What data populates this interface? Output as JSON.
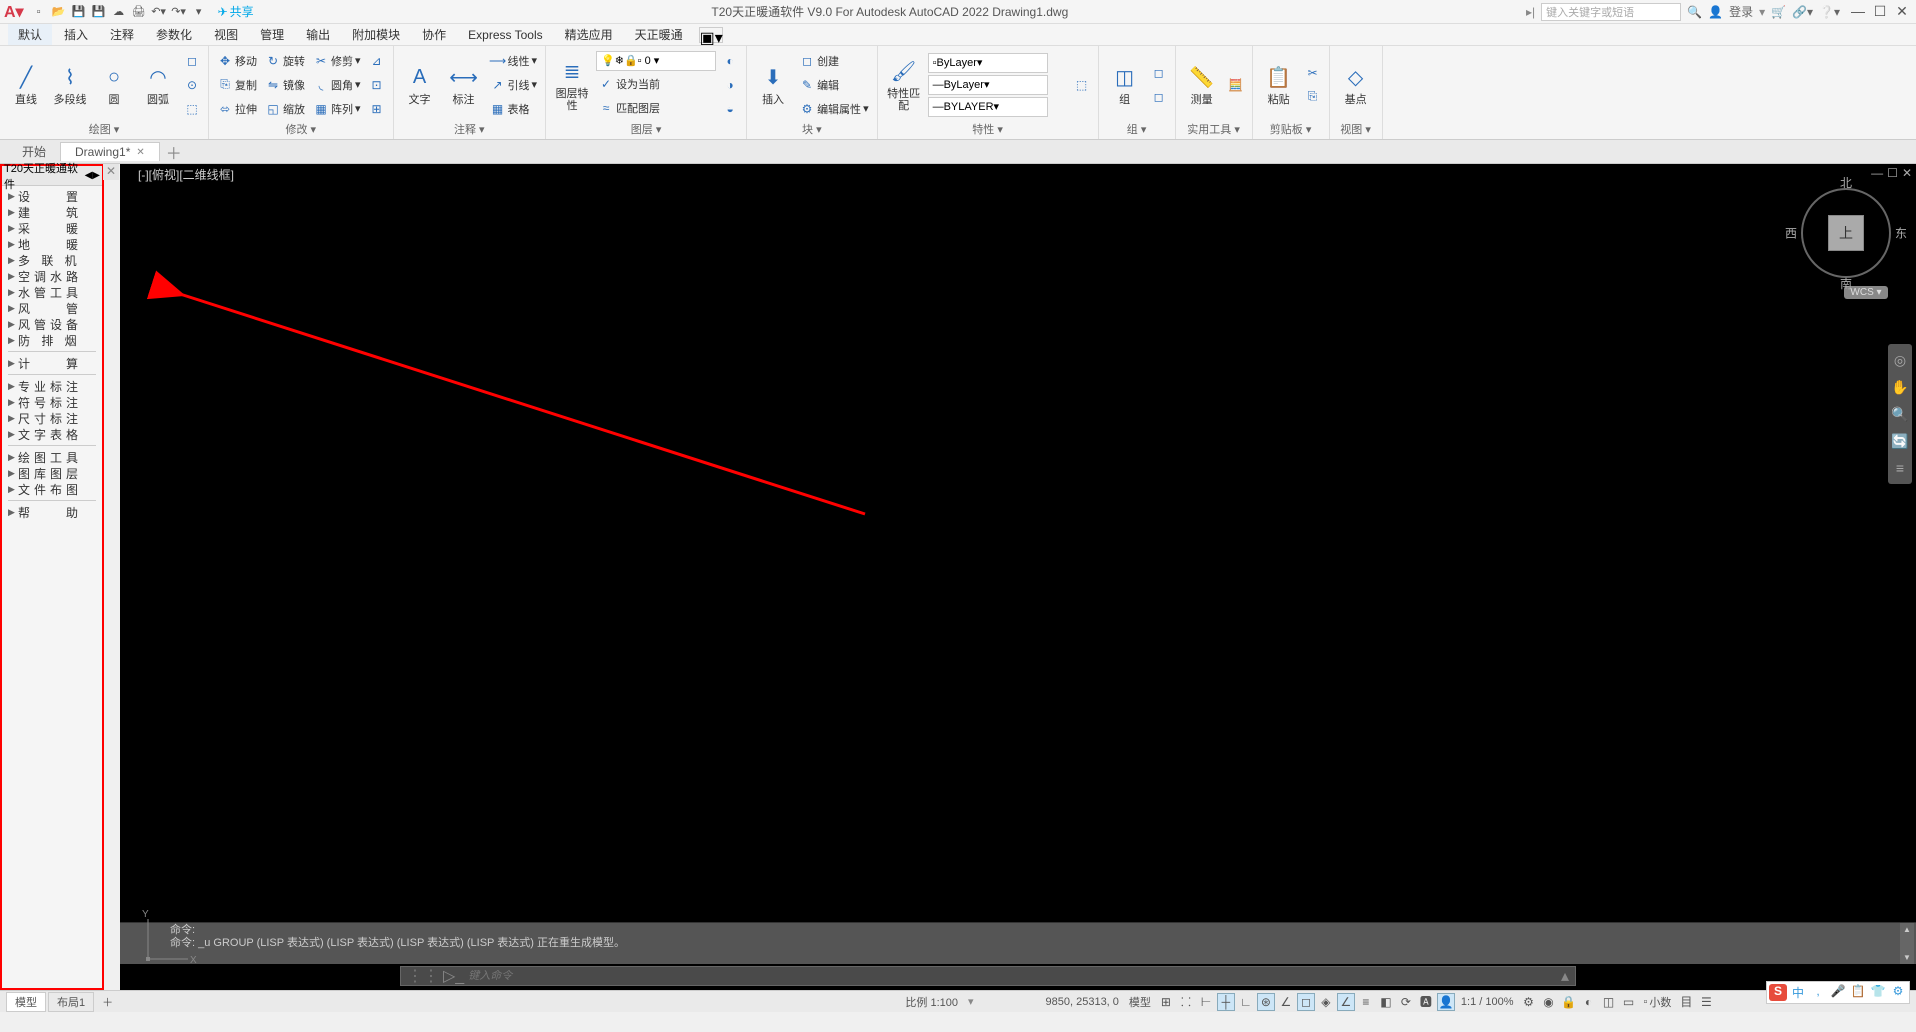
{
  "title": "T20天正暖通软件 V9.0 For Autodesk AutoCAD 2022   Drawing1.dwg",
  "share": "共享",
  "search_placeholder": "键入关键字或短语",
  "login": "登录",
  "menu_tabs": [
    "默认",
    "插入",
    "注释",
    "参数化",
    "视图",
    "管理",
    "输出",
    "附加模块",
    "协作",
    "Express Tools",
    "精选应用",
    "天正暖通"
  ],
  "ribbon": {
    "draw": {
      "line": "直线",
      "polyline": "多段线",
      "circle": "圆",
      "arc": "圆弧",
      "title": "绘图 ▾"
    },
    "modify": {
      "move": "移动",
      "rotate": "旋转",
      "trim": "修剪",
      "copy": "复制",
      "mirror": "镜像",
      "fillet": "圆角",
      "stretch": "拉伸",
      "scale": "缩放",
      "array": "阵列",
      "title": "修改 ▾"
    },
    "annot": {
      "text": "文字",
      "dim": "标注",
      "leader": "引线",
      "table": "表格",
      "linear": "线性",
      "title": "注释 ▾"
    },
    "layer": {
      "props": "图层特性",
      "title": "图层 ▾",
      "current": "设为当前",
      "match": "匹配图层"
    },
    "block": {
      "insert": "插入",
      "create": "创建",
      "edit": "编辑",
      "attrib": "编辑属性",
      "title": "块 ▾"
    },
    "props": {
      "match": "特性匹配",
      "bylayer": "ByLayer",
      "bylayer2": "ByLayer",
      "bylayer3": "BYLAYER",
      "title": "特性 ▾"
    },
    "group": {
      "group": "组",
      "title": "组 ▾"
    },
    "util": {
      "measure": "测量",
      "title": "实用工具 ▾"
    },
    "clip": {
      "paste": "粘贴",
      "title": "剪贴板 ▾"
    },
    "view": {
      "base": "基点",
      "title": "视图 ▾"
    }
  },
  "doc_tabs": {
    "start": "开始",
    "active": "Drawing1*"
  },
  "side_panel": {
    "title": "T20天正暖通软件",
    "items": [
      "设　　置",
      "建　　筑",
      "采　　暖",
      "地　　暖",
      "多 联 机",
      "空调水路",
      "水管工具",
      "风　　管",
      "风管设备",
      "防 排 烟"
    ],
    "items2": [
      "计　　算"
    ],
    "items3": [
      "专业标注",
      "符号标注",
      "尺寸标注",
      "文字表格"
    ],
    "items4": [
      "绘图工具",
      "图库图层",
      "文件布图"
    ],
    "items5": [
      "帮　　助"
    ]
  },
  "viewport_label": "[-][俯视][二维线框]",
  "viewcube": {
    "n": "北",
    "s": "南",
    "e": "东",
    "w": "西",
    "face": "上",
    "wcs": "WCS ▾"
  },
  "cmd": {
    "label": "命令:",
    "history": "命令: _u GROUP (LISP 表达式) (LISP 表达式) (LISP 表达式) (LISP 表达式) 正在重生成模型。",
    "placeholder": "键入命令"
  },
  "status": {
    "model": "模型",
    "layout": "布局1",
    "scale": "比例 1:100",
    "coords": "9850, 25313, 0",
    "model2": "模型",
    "ratio": "1:1 / 100%",
    "decimal": "小数"
  },
  "ime": {
    "s": "S",
    "items": [
      "中",
      ",",
      "🎤",
      "📋",
      "👕",
      "⚙"
    ]
  }
}
